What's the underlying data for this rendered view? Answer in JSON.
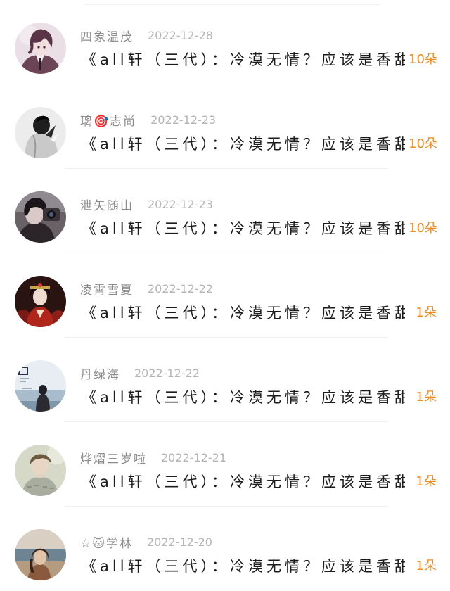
{
  "colors": {
    "background": "#ffffff",
    "name_text": "#8c8c8c",
    "date_text": "#b5b5b5",
    "title_text": "#1c1c1c",
    "count_accent": "#f08a1e",
    "divider": "#f0f0f0"
  },
  "entries": [
    {
      "username": "四象温茂",
      "date": "2022-12-28",
      "title": "《all轩（三代）：冷漠无情？应该是香甜…",
      "count": "10朵",
      "avatar_icon": "anime-boy-avatar-icon"
    },
    {
      "username": "璃🎯志尚",
      "date": "2022-12-23",
      "title": "《all轩（三代）：冷漠无情？应该是香甜…",
      "count": "10朵",
      "avatar_icon": "black-white-portrait-avatar-icon"
    },
    {
      "username": "泄矢随山",
      "date": "2022-12-23",
      "title": "《all轩（三代）：冷漠无情？应该是香甜…",
      "count": "10朵",
      "avatar_icon": "camera-girl-avatar-icon"
    },
    {
      "username": "凌霄雪夏",
      "date": "2022-12-22",
      "title": "《all轩（三代）：冷漠无情？应该是香甜…",
      "count": "1朵",
      "avatar_icon": "red-costume-avatar-icon"
    },
    {
      "username": "丹绿海",
      "date": "2022-12-22",
      "title": "《all轩（三代）：冷漠无情？应该是香甜…",
      "count": "1朵",
      "avatar_icon": "seaside-girl-avatar-icon"
    },
    {
      "username": "烨熠三岁啦",
      "date": "2022-12-21",
      "title": "《all轩（三代）：冷漠无情？应该是香甜…",
      "count": "1朵",
      "avatar_icon": "young-man-avatar-icon"
    },
    {
      "username": "☆🐱学林",
      "date": "2022-12-20",
      "title": "《all轩（三代）：冷漠无情？应该是香甜…",
      "count": "1朵",
      "avatar_icon": "beach-girl-avatar-icon"
    }
  ]
}
